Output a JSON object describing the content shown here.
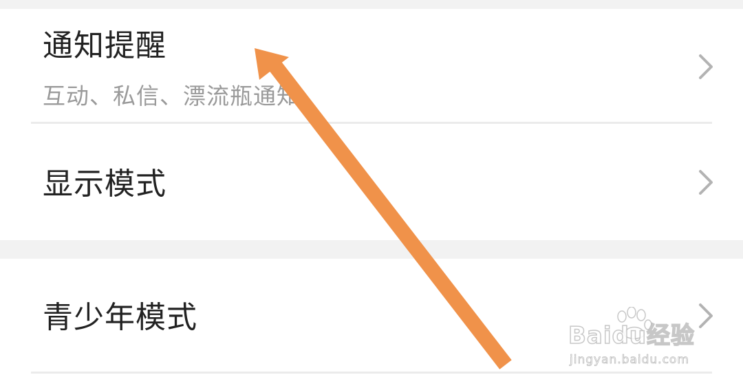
{
  "settings": {
    "items": [
      {
        "title": "通知提醒",
        "subtitle": "互动、私信、漂流瓶通知"
      },
      {
        "title": "显示模式"
      },
      {
        "title": "青少年模式"
      }
    ]
  },
  "watermark": {
    "logo_text": "Baidu经验",
    "url": "jingyan.baidu.com"
  },
  "colors": {
    "background": "#f2f2f2",
    "card": "#ffffff",
    "title_text": "#222222",
    "subtitle_text": "#9a9a9a",
    "chevron": "#b3b3b3",
    "arrow": "#f0924a"
  },
  "icons": {
    "chevron": "chevron-right-icon",
    "annotation": "orange-arrow-icon"
  }
}
